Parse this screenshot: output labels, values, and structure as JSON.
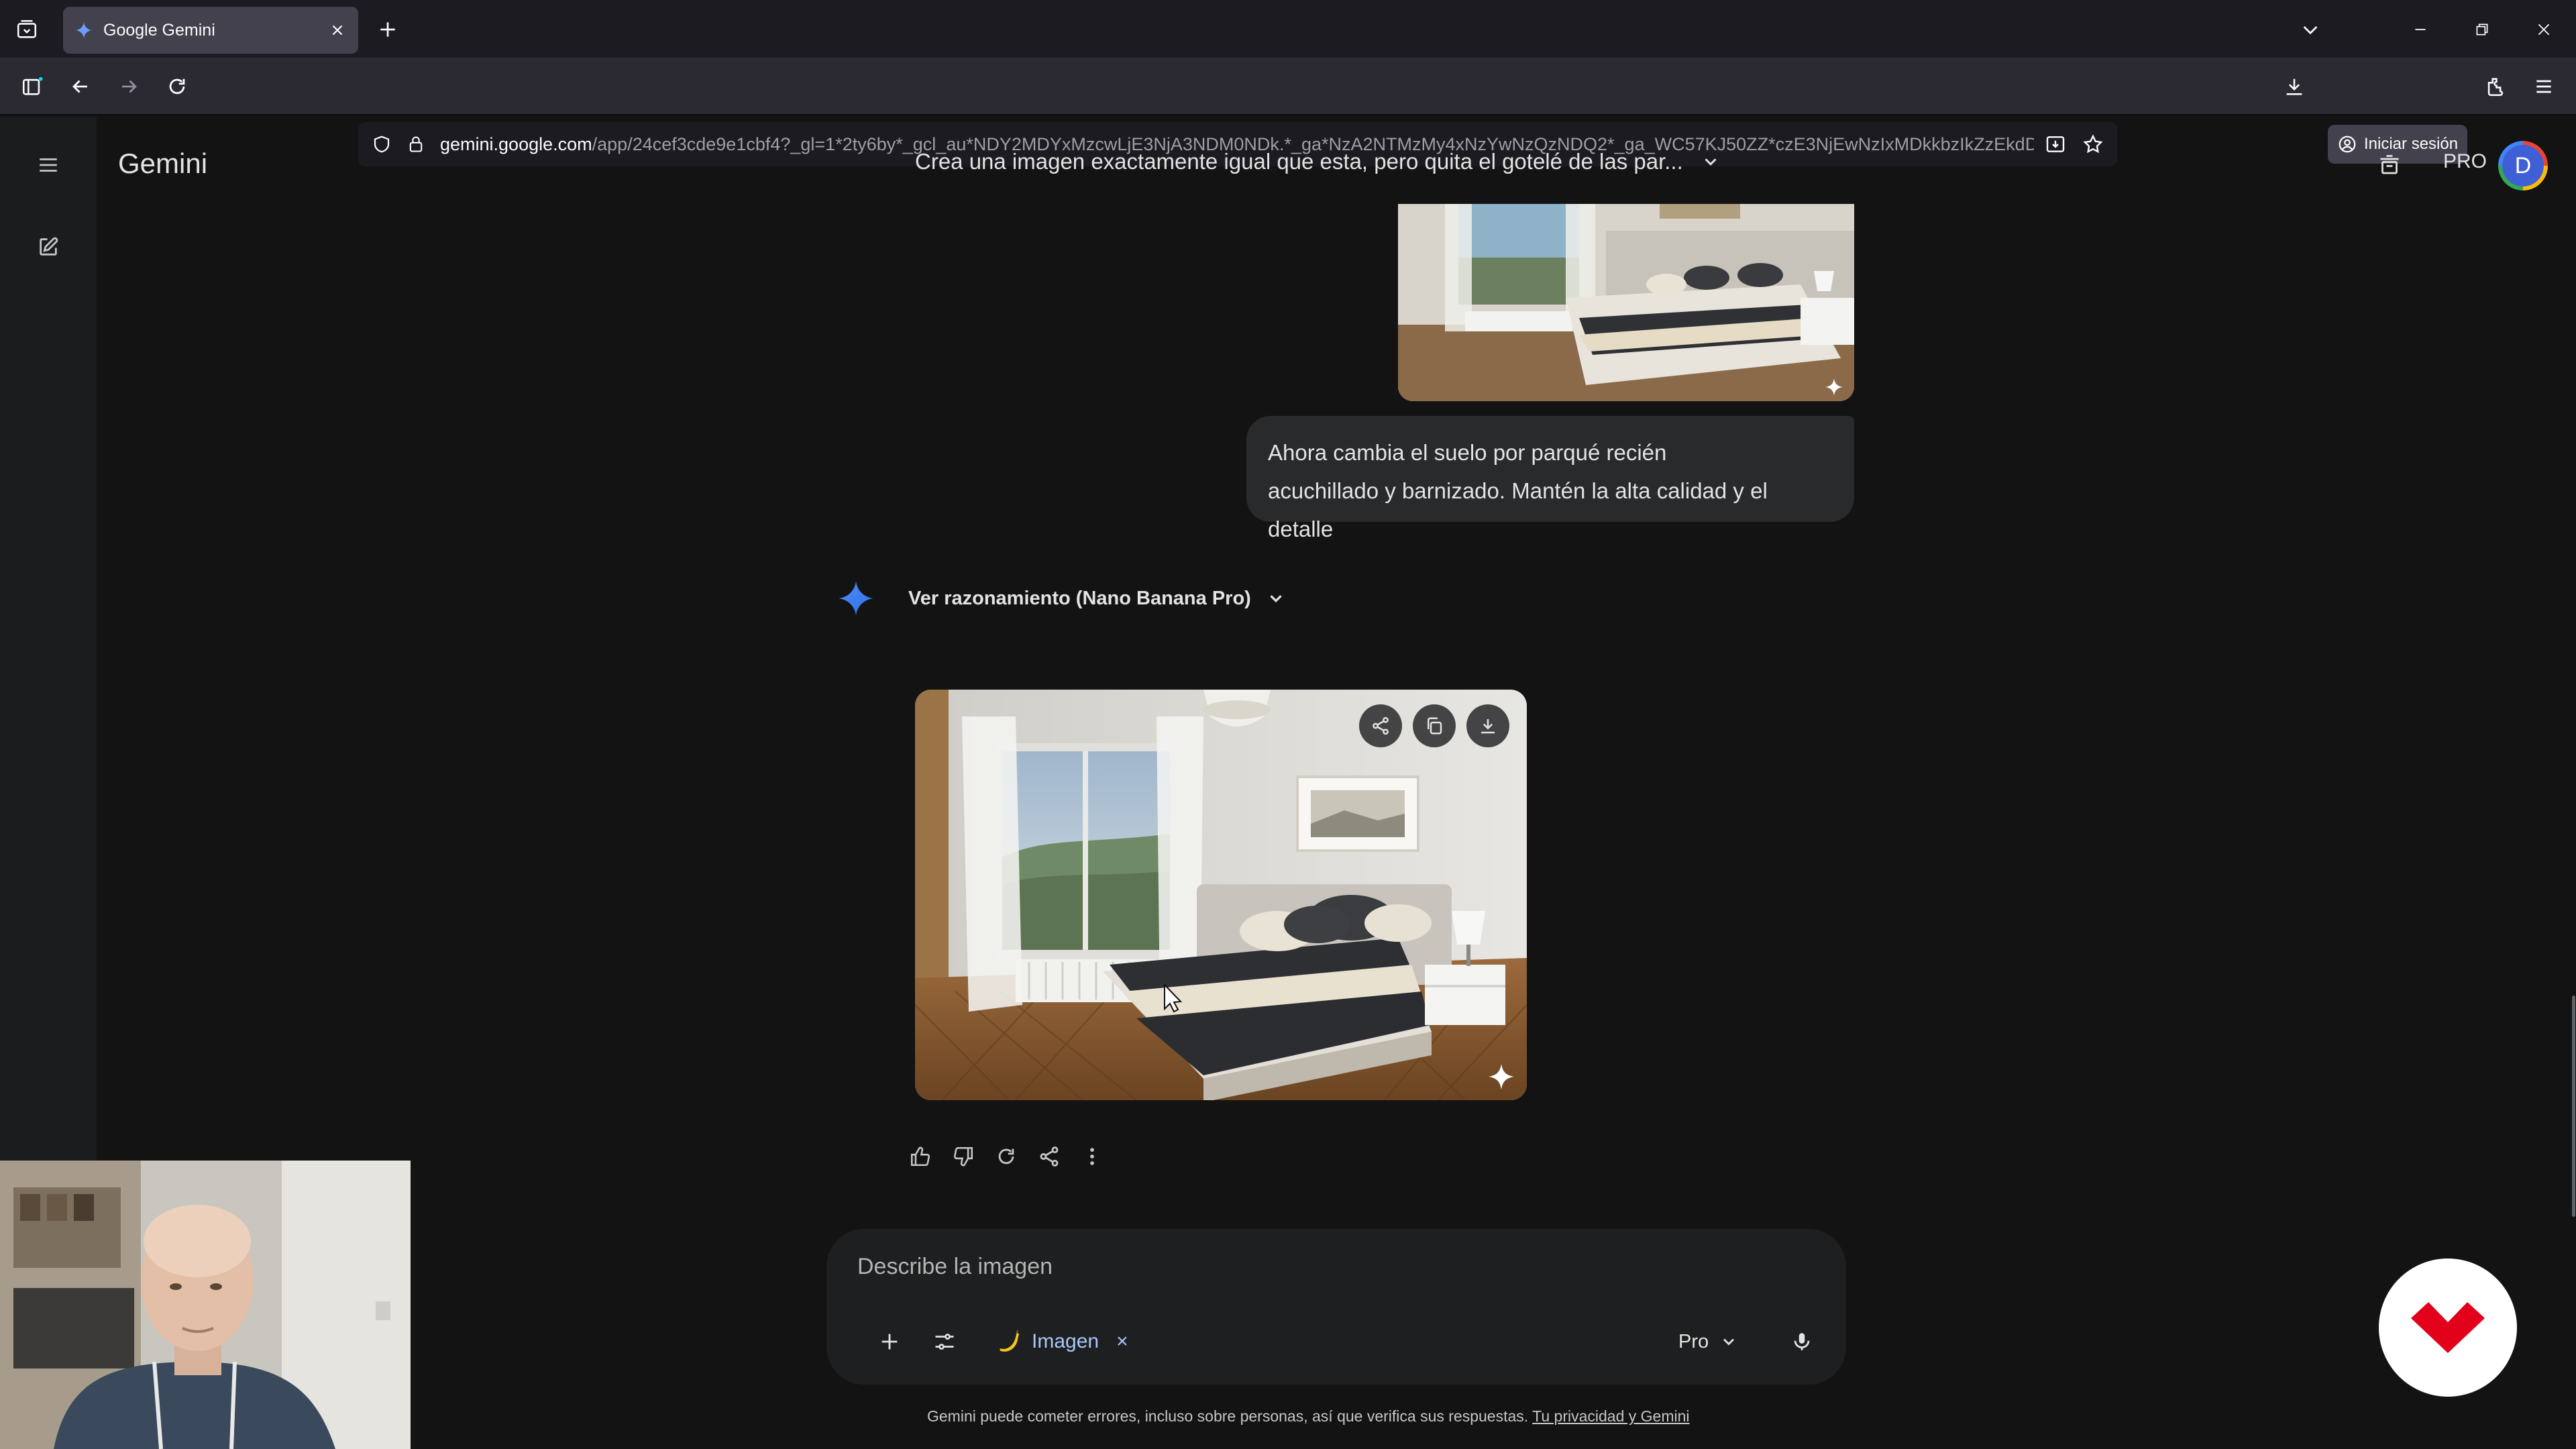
{
  "browser": {
    "tab": {
      "title": "Google Gemini",
      "favicon": "gemini-sparkle-icon"
    },
    "url": {
      "host": "gemini.google.com",
      "path": "/app/24cef3cde9e1cbf4?_gl=1*2ty6by*_gcl_au*NDY2MDYxMzcwLjE3NjA3NDM0NDk.*_ga*NzA2NTMzMy4xNzYwNzQzNDQ2*_ga_WC57KJ50ZZ*czE3NjEwNzIxMDkkbzIkZzEkdD"
    },
    "signin_label": "Iniciar sesión",
    "icons": [
      "tab-list-icon",
      "new-tab-icon",
      "chevron-down-icon",
      "minimize-icon",
      "restore-icon",
      "close-icon",
      "sidebar-icon",
      "back-icon",
      "forward-icon",
      "reload-icon",
      "shield-icon",
      "lock-icon",
      "install-icon",
      "bookmark-star-icon",
      "download-icon",
      "account-icon",
      "extensions-icon",
      "menu-icon"
    ]
  },
  "app": {
    "name": "Gemini",
    "conversation_title": "Crea una imagen exactamente igual que esta, pero quita el gotelé de las par...",
    "plan_label": "PRO",
    "avatar_letter": "D"
  },
  "conversation": {
    "user_message": {
      "line1": "Ahora cambia el suelo por parqué recién",
      "line2": "acuchillado y barnizado. Mantén la alta calidad y el detalle"
    },
    "reasoning_label": "Ver razonamiento (Nano Banana Pro)",
    "generated_image": {
      "description_icon": "bedroom-image",
      "overlay_buttons": [
        "share-icon",
        "copy-icon",
        "download-icon"
      ]
    },
    "response_actions": [
      "thumbs-up-icon",
      "thumbs-down-icon",
      "regenerate-icon",
      "share-icon",
      "more-icon"
    ]
  },
  "composer": {
    "placeholder": "Describe la imagen",
    "tool_chip_label": "Imagen",
    "tool_chip_remove": "×",
    "model_label": "Pro"
  },
  "footer": {
    "disclaimer": "Gemini puede cometer errores, incluso sobre personas, así que verifica sus respuestas.",
    "privacy_link": "Tu privacidad y Gemini"
  },
  "colors": {
    "background": "#131314",
    "sidebar": "#1b1c1d",
    "bubble": "#282a2c",
    "composer": "#1e1f20",
    "accent_blue": "#a8c7fa",
    "brand_red": "#e3001b"
  }
}
